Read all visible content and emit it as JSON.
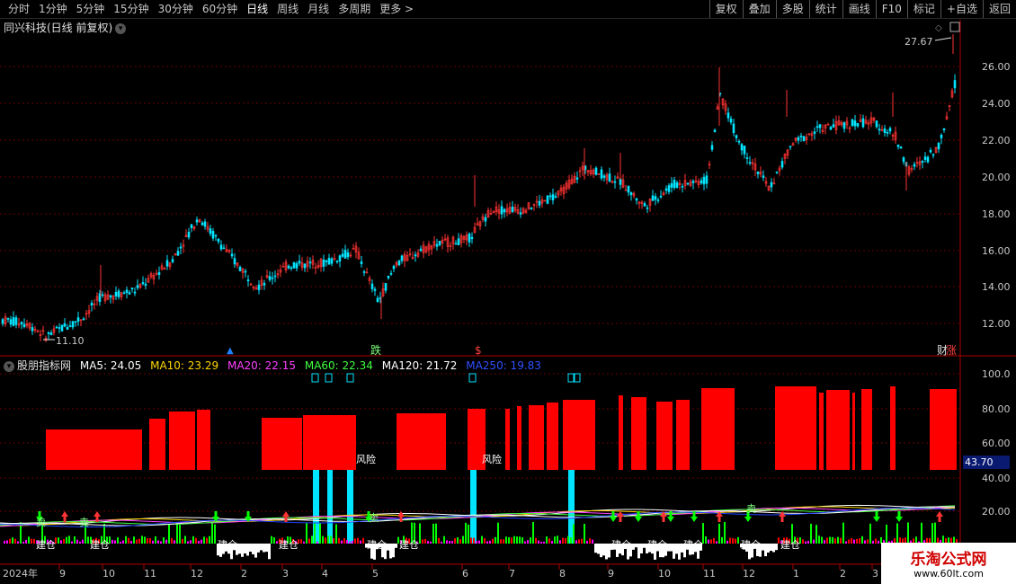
{
  "toolbar": {
    "periods": [
      "分时",
      "1分钟",
      "5分钟",
      "15分钟",
      "30分钟",
      "60分钟",
      "日线",
      "周线",
      "月线",
      "多周期",
      "更多 >"
    ],
    "active_period": "日线",
    "actions": [
      "复权",
      "叠加",
      "多股",
      "统计",
      "画线",
      "F10",
      "标记",
      "+自选",
      "返回"
    ]
  },
  "stock_title": "同兴科技(日线 前复权)",
  "price_marks": {
    "high": "27.67",
    "low": "11.10"
  },
  "price_axis": [
    "26.00",
    "24.00",
    "22.00",
    "20.00",
    "18.00",
    "16.00",
    "14.00",
    "12.00"
  ],
  "signals": {
    "die": "跌",
    "s": "$",
    "zhang": "涨",
    "cai": "财"
  },
  "indicator": {
    "name": "股朋指标网",
    "ma": [
      {
        "label": "MA5: 24.05",
        "color": "#ffffff"
      },
      {
        "label": "MA10: 23.29",
        "color": "#ffd700"
      },
      {
        "label": "MA20: 22.15",
        "color": "#ff40ff"
      },
      {
        "label": "MA60: 22.34",
        "color": "#40ff40"
      },
      {
        "label": "MA120: 21.72",
        "color": "#ffffff"
      },
      {
        "label": "MA250: 19.83",
        "color": "#2040ff"
      }
    ]
  },
  "ind_axis": [
    "100.0",
    "80.00",
    "60.00",
    "40.00",
    "20.00"
  ],
  "current_value": "43.70",
  "ind_labels": {
    "risk": "风险",
    "build": "建仓",
    "sell": "卖"
  },
  "date_axis": [
    "2024年",
    "9",
    "10",
    "11",
    "12",
    "2",
    "3",
    "4",
    "5",
    "6",
    "7",
    "8",
    "9",
    "10",
    "11",
    "12",
    "1",
    "2",
    "3"
  ],
  "watermark": {
    "name": "乐淘公式网",
    "url": "www.60lt.com"
  },
  "colors": {
    "up": "#ff3333",
    "down": "#00e5ff",
    "volume_red": "#ff0000",
    "cyan": "#00e5ff",
    "axis": "#b00000"
  }
}
